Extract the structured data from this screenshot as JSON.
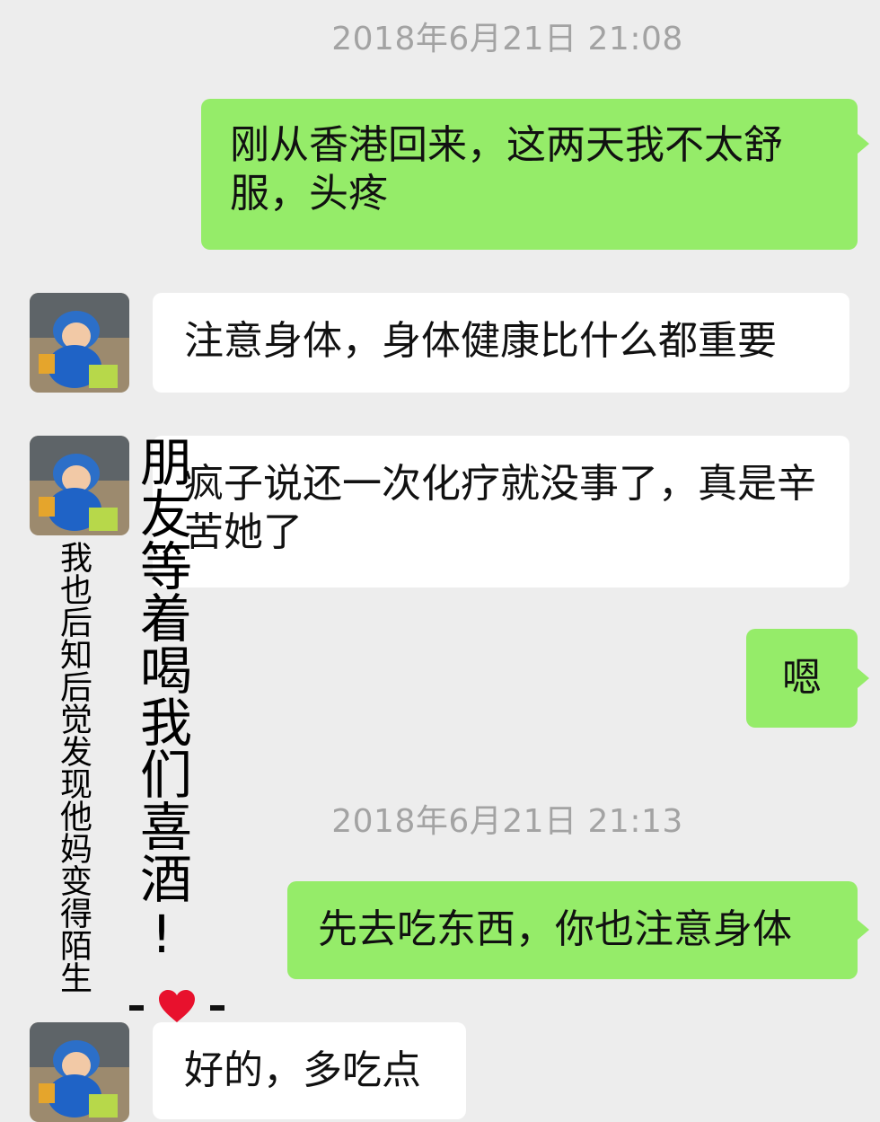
{
  "chat": {
    "timestamps": [
      "2018年6月21日 21:08",
      "2018年6月21日 21:13"
    ],
    "messages": [
      {
        "from": "me",
        "text": "刚从香港回来，这两天我不太舒服，头疼"
      },
      {
        "from": "friend",
        "text": "注意身体，身体健康比什么都重要"
      },
      {
        "from": "friend",
        "text": "疯子说还一次化疗就没事了，真是辛苦她了"
      },
      {
        "from": "me",
        "text": "嗯"
      },
      {
        "from": "me",
        "text": "先去吃东西，你也注意身体"
      },
      {
        "from": "friend",
        "text": "好的，多吃点"
      }
    ]
  },
  "overlay": {
    "left_caption": "我也后知后觉发现他妈变得陌生",
    "right_caption": "朋友等着喝我们喜酒!"
  },
  "colors": {
    "background": "#ededed",
    "my_bubble": "#95ec69",
    "friend_bubble": "#ffffff",
    "timestamp": "#a3a3a3",
    "heart": "#e8112d"
  },
  "icons": {
    "avatar": "child-in-blue-jacket-photo",
    "heart": "heart-icon"
  }
}
